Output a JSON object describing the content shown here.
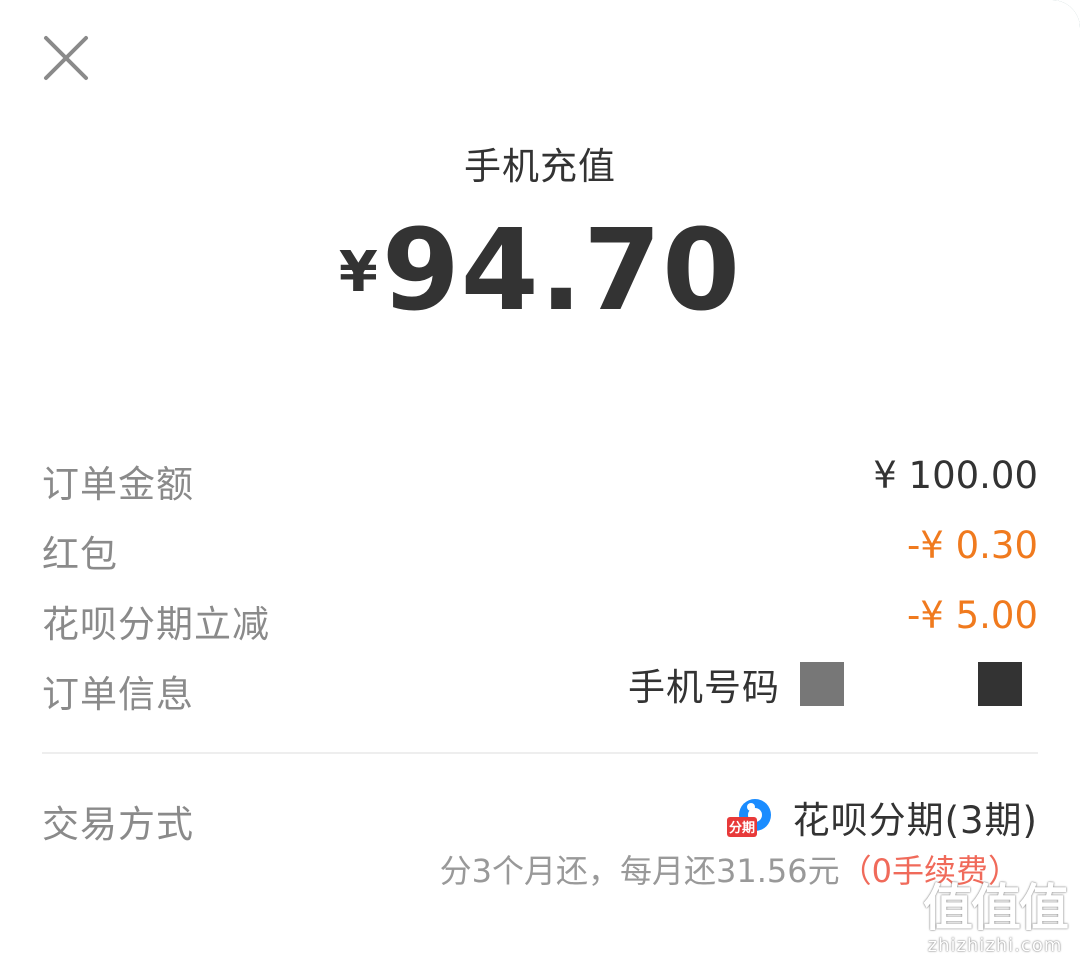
{
  "header": {
    "title": "手机充值",
    "currency_symbol": "¥",
    "amount": "94.70"
  },
  "details": {
    "order_amount": {
      "label": "订单金额",
      "value": "¥ 100.00"
    },
    "red_packet": {
      "label": "红包",
      "value": "-¥ 0.30"
    },
    "huabei_discount": {
      "label": "花呗分期立减",
      "value": "-¥ 5.00"
    },
    "order_info": {
      "label": "订单信息",
      "value": "手机号码"
    }
  },
  "payment": {
    "label": "交易方式",
    "method": "花呗分期(3期)",
    "icon_text": "分期",
    "installment_text": "分3个月还，每月还31.56元",
    "fee_text": "（0手续费）"
  },
  "watermark": {
    "big": "值值值",
    "small": "zhizhizhi.com"
  },
  "colors": {
    "text_primary": "#333333",
    "text_secondary": "#8a8a8a",
    "discount": "#f07a1e",
    "fee": "#f06a5a",
    "huabei_blue": "#1a8cff",
    "huabei_red": "#e83a3a"
  },
  "icons": {
    "close": "close-icon",
    "huabei": "huabei-installment-icon"
  }
}
